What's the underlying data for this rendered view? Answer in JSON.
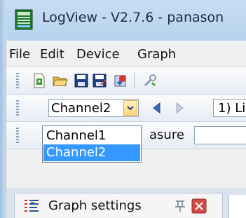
{
  "window": {
    "title": "LogView - V2.7.6 - panason",
    "accent": "#3399ff",
    "titlebar_color": "#bfd8f1"
  },
  "menu": {
    "items": [
      "File",
      "Edit",
      "Device",
      "Graph"
    ]
  },
  "toolbar_main": {
    "icons": [
      "new-file-icon",
      "open-folder-icon",
      "save-icon",
      "save-as-icon",
      "import-icon",
      "tools-icon"
    ]
  },
  "channel_toolbar": {
    "selected_channel": "Channel2",
    "step_text": "1) Li"
  },
  "measure_toolbar": {
    "label": "asure"
  },
  "channel_dropdown": {
    "options": [
      "Channel1",
      "Channel2"
    ],
    "selected": "Channel2"
  },
  "panel": {
    "title": "Graph settings"
  }
}
